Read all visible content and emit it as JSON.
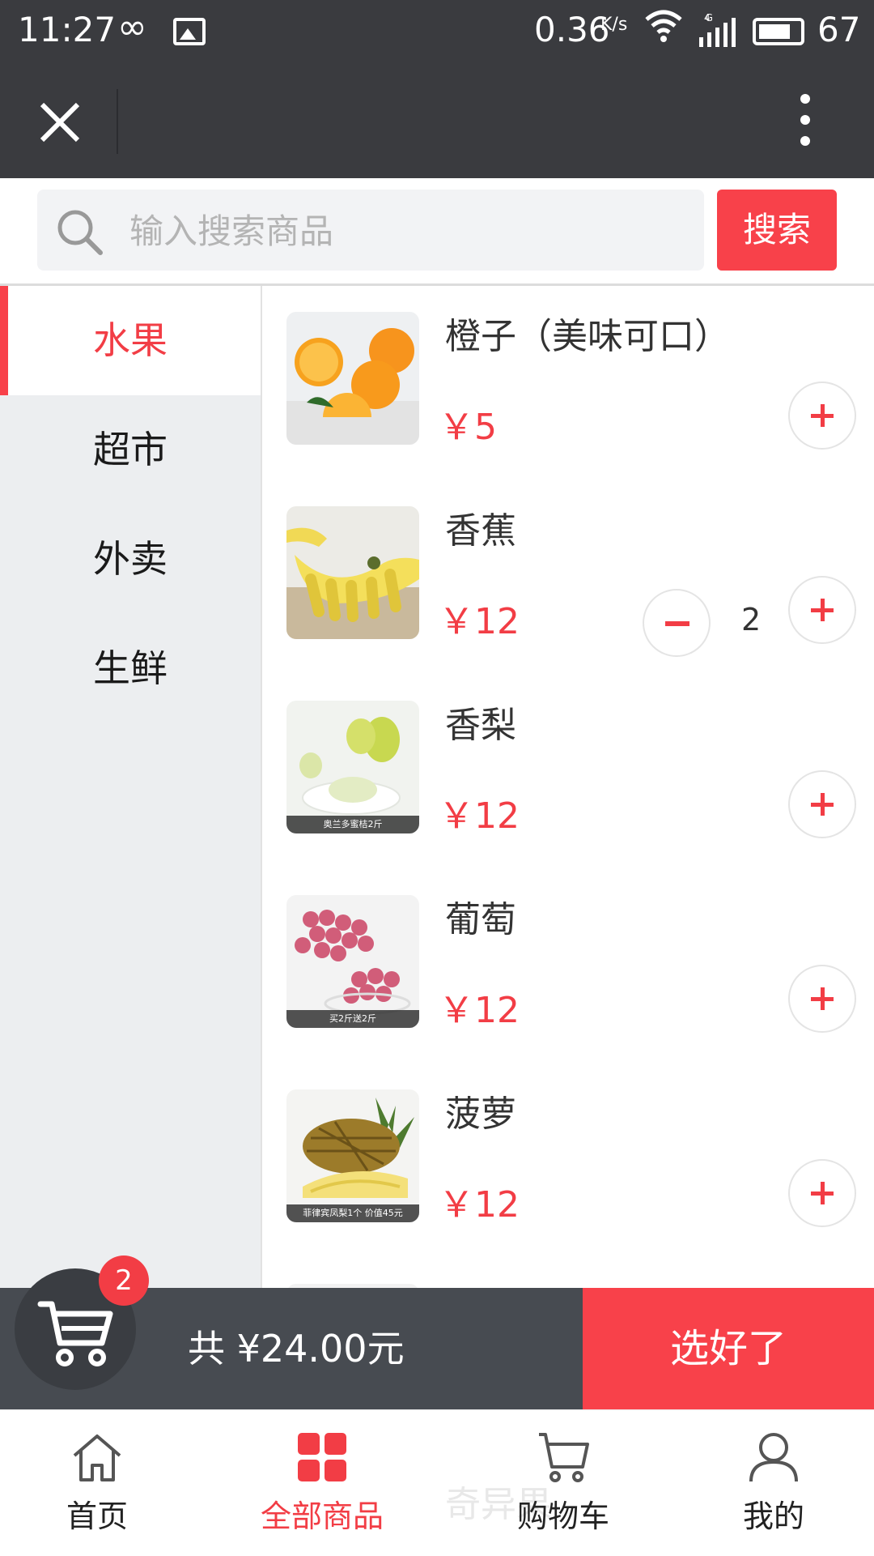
{
  "status_bar": {
    "time": "11:27",
    "speed": "0.36",
    "speed_unit": "K/s",
    "network": "4G",
    "battery": "67"
  },
  "search": {
    "placeholder": "输入搜索商品",
    "button_label": "搜索"
  },
  "categories": [
    {
      "label": "水果",
      "active": true
    },
    {
      "label": "超市",
      "active": false
    },
    {
      "label": "外卖",
      "active": false
    },
    {
      "label": "生鲜",
      "active": false
    }
  ],
  "products": [
    {
      "name": "橙子（美味可口）",
      "price": "￥5",
      "image": "orange",
      "caption": ""
    },
    {
      "name": "香蕉",
      "price": "￥12",
      "image": "banana",
      "caption": "",
      "quantity": "2"
    },
    {
      "name": "香梨",
      "price": "￥12",
      "image": "pear",
      "caption": "奥兰多蜜桔2斤"
    },
    {
      "name": "葡萄",
      "price": "￥12",
      "image": "grape",
      "caption": "买2斤送2斤"
    },
    {
      "name": "菠萝",
      "price": "￥12",
      "image": "pineapple",
      "caption": "菲律宾凤梨1个 价值45元"
    }
  ],
  "cart": {
    "badge": "2",
    "total": "共 ¥24.00元",
    "checkout_label": "选好了"
  },
  "bottom_nav": {
    "ghost_text": "奇异果",
    "items": [
      {
        "label": "首页",
        "icon": "home-icon",
        "active": false
      },
      {
        "label": "全部商品",
        "icon": "grid-icon",
        "active": true
      },
      {
        "label": "购物车",
        "icon": "cart-icon",
        "active": false
      },
      {
        "label": "我的",
        "icon": "user-icon",
        "active": false
      }
    ]
  },
  "colors": {
    "accent": "#f8414a",
    "header": "#3a3b3f",
    "cart_bar": "#474b51"
  }
}
